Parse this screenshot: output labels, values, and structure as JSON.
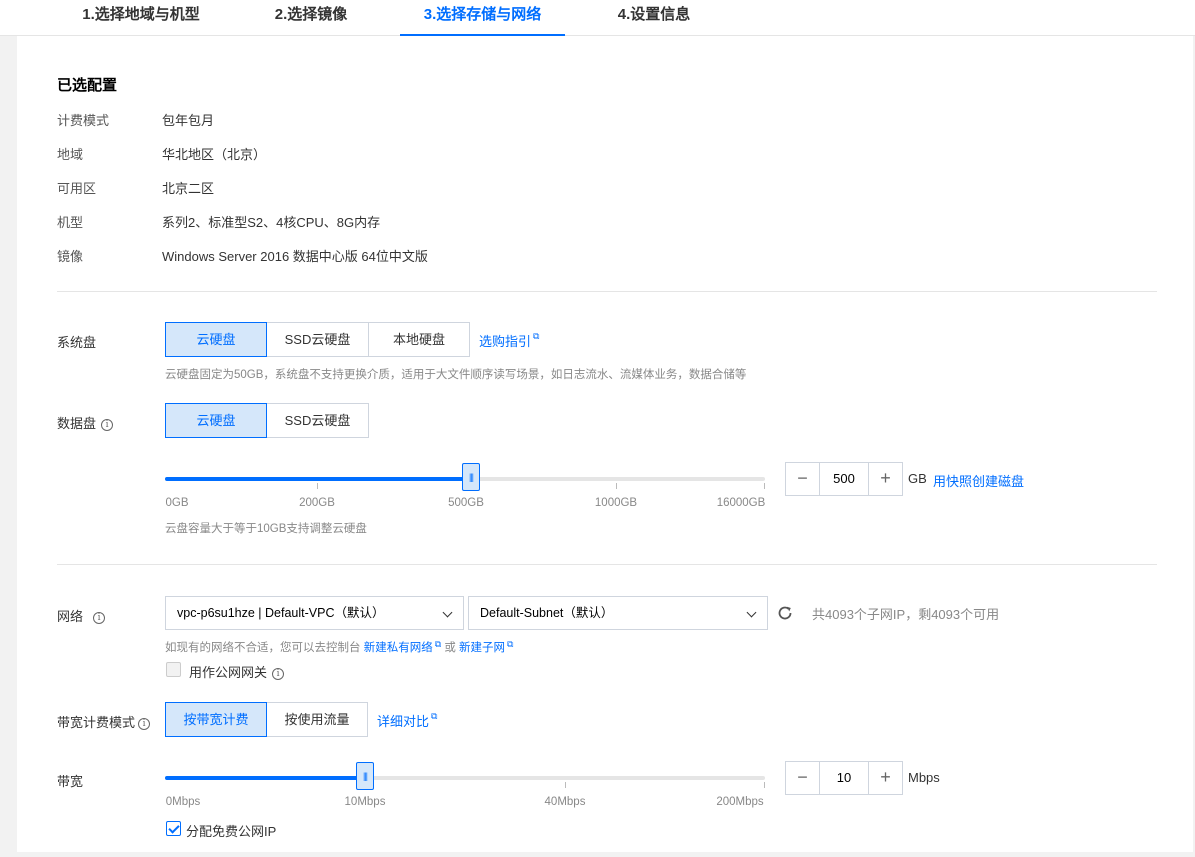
{
  "tabs": [
    {
      "label": "1.选择地域与机型"
    },
    {
      "label": "2.选择镜像"
    },
    {
      "label": "3.选择存储与网络"
    },
    {
      "label": "4.设置信息"
    }
  ],
  "config": {
    "title": "已选配置",
    "rows": [
      {
        "label": "计费模式",
        "value": "包年包月"
      },
      {
        "label": "地域",
        "value": "华北地区（北京）"
      },
      {
        "label": "可用区",
        "value": "北京二区"
      },
      {
        "label": "机型",
        "value": "系列2、标准型S2、4核CPU、8G内存"
      },
      {
        "label": "镜像",
        "value": "Windows Server 2016 数据中心版 64位中文版"
      }
    ]
  },
  "system_disk": {
    "label": "系统盘",
    "options": [
      "云硬盘",
      "SSD云硬盘",
      "本地硬盘"
    ],
    "selected": "云硬盘",
    "guide_link": "选购指引",
    "hint": "云硬盘固定为50GB，系统盘不支持更换介质，适用于大文件顺序读写场景，如日志流水、流媒体业务，数据合储等"
  },
  "data_disk": {
    "label": "数据盘",
    "info_icon": "info-icon",
    "options": [
      "云硬盘",
      "SSD云硬盘"
    ],
    "selected": "云硬盘",
    "ticks": [
      "0GB",
      "200GB",
      "500GB",
      "1000GB",
      "16000GB"
    ],
    "value": "500",
    "unit": "GB",
    "snapshot_link": "用快照创建磁盘",
    "hint": "云盘容量大于等于10GB支持调整云硬盘"
  },
  "network": {
    "label": "网络",
    "vpc": "vpc-p6su1hze | Default-VPC（默认）",
    "subnet": "Default-Subnet（默认）",
    "ip_info": "共4093个子网IP，剩4093个可用",
    "hint_prefix": "如现有的网络不合适，您可以去控制台",
    "new_vpc_link": "新建私有网络",
    "or": "或",
    "new_subnet_link": "新建子网",
    "gateway_label": "用作公网网关",
    "gateway_checked": false
  },
  "billing": {
    "label": "带宽计费模式",
    "options": [
      "按带宽计费",
      "按使用流量"
    ],
    "selected": "按带宽计费",
    "compare_link": "详细对比"
  },
  "bandwidth": {
    "label": "带宽",
    "ticks": [
      "0Mbps",
      "10Mbps",
      "40Mbps",
      "200Mbps"
    ],
    "value": "10",
    "unit": "Mbps",
    "public_ip_label": "分配免费公网IP",
    "public_ip_checked": true
  },
  "colors": {
    "accent": "#006eff",
    "selected_bg": "#d5e7fa"
  }
}
